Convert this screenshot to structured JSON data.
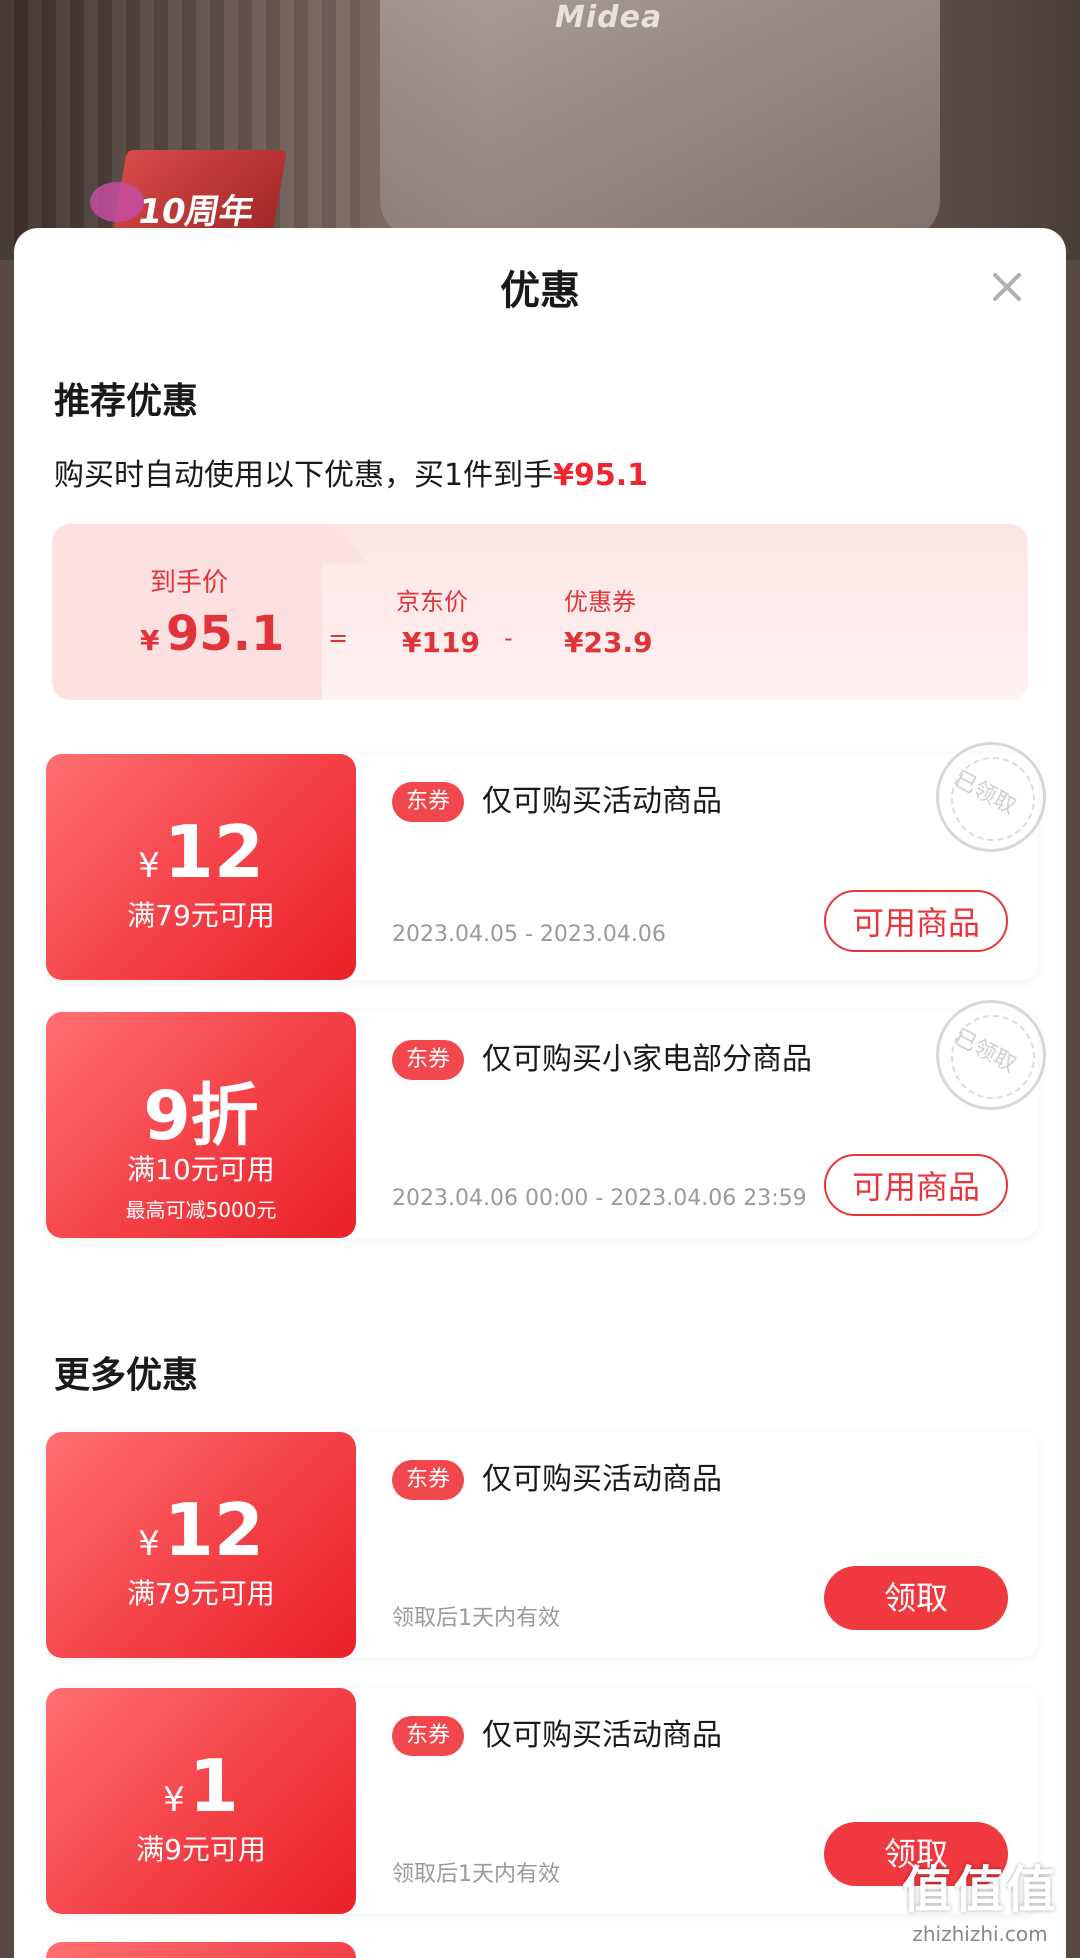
{
  "background": {
    "brand_logo": "Midea",
    "badge_text": "10周年"
  },
  "sheet": {
    "title": "优惠",
    "close_icon": "close-icon"
  },
  "recommended": {
    "section_title": "推荐优惠",
    "auto_prefix": "购买时自动使用以下优惠，买1件到手",
    "auto_price": "¥95.1",
    "summary": {
      "final_label": "到手价",
      "final_yen": "¥",
      "final_value": "95.1",
      "equals": "=",
      "jd_label": "京东价",
      "jd_value": "¥119",
      "minus": "-",
      "coupon_label": "优惠券",
      "coupon_value": "¥23.9"
    },
    "coupons": [
      {
        "yen": "¥",
        "amount": "12",
        "condition": "满79元可用",
        "tag": "东券",
        "desc": "仅可购买活动商品",
        "date": "2023.04.05 - 2023.04.06",
        "button": "可用商品",
        "stamp": "已领取"
      },
      {
        "yen": "",
        "amount": "9折",
        "condition": "满10元可用",
        "sub": "最高可减5000元",
        "tag": "东券",
        "desc": "仅可购买小家电部分商品",
        "date": "2023.04.06 00:00 - 2023.04.06 23:59",
        "button": "可用商品",
        "stamp": "已领取"
      }
    ]
  },
  "more": {
    "section_title": "更多优惠",
    "coupons": [
      {
        "yen": "¥",
        "amount": "12",
        "condition": "满79元可用",
        "tag": "东券",
        "desc": "仅可购买活动商品",
        "date": "领取后1天内有效",
        "button": "领取"
      },
      {
        "yen": "¥",
        "amount": "1",
        "condition": "满9元可用",
        "tag": "东券",
        "desc": "仅可购买活动商品",
        "date": "领取后1天内有效",
        "button": "领取"
      }
    ]
  },
  "watermark": {
    "big": "值值值",
    "small": "zhizhizhi.com"
  },
  "colors": {
    "accent": "#f0383f",
    "price_red": "#f0262f",
    "summary_bg": "#fde4e4"
  }
}
